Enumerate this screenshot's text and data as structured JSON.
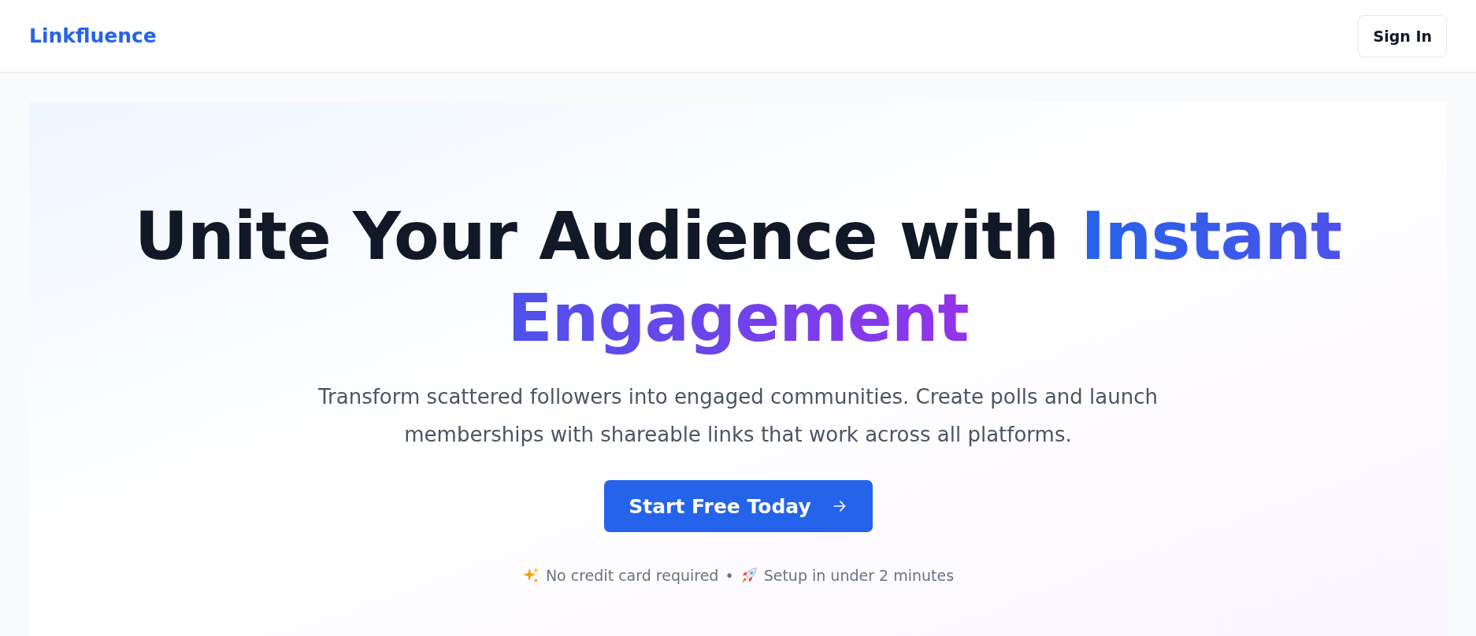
{
  "header": {
    "logo": "Linkfluence",
    "sign_in": "Sign In"
  },
  "hero": {
    "heading": "Unite Your Audience with",
    "heading_highlight": "Instant Engagement",
    "subtitle": "Transform scattered followers into engaged communities. Create polls and launch memberships with shareable links that work across all platforms.",
    "cta": "Start Free Today",
    "notes": [
      "No credit card required",
      "Setup in under 2 minutes"
    ],
    "separator": "•"
  }
}
